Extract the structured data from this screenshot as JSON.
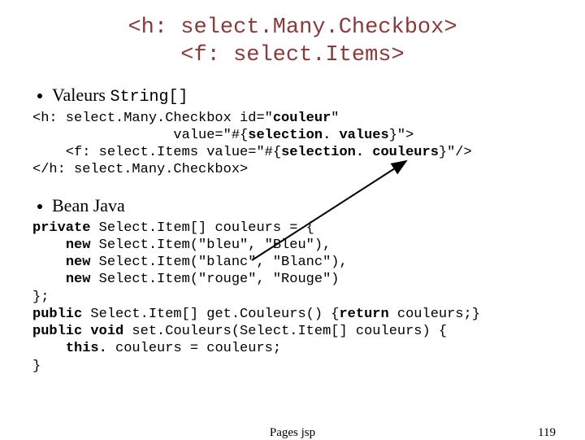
{
  "title_line1": "<h: select.Many.Checkbox>",
  "title_line2": "<f: select.Items>",
  "bullet1_text": "Valeurs ",
  "bullet1_code": "String[]",
  "code1_l1a": "<h: select.Many.Checkbox id=\"",
  "code1_l1b": "couleur",
  "code1_l1c": "\"",
  "code1_l2a": "                 value=\"#{",
  "code1_l2b": "selection. values",
  "code1_l2c": "}\">",
  "code1_l3a": "    <f: select.Items value=\"#{",
  "code1_l3b": "selection. couleurs",
  "code1_l3c": "}\"/>",
  "code1_l4": "</h: select.Many.Checkbox>",
  "bullet2_text": "Bean Java",
  "code2_l1a": "private",
  "code2_l1b": " Select.Item[] couleurs = {",
  "code2_l2a": "    ",
  "code2_l2b": "new",
  "code2_l2c": " Select.Item(\"bleu\", \"Bleu\"),",
  "code2_l3a": "    ",
  "code2_l3b": "new",
  "code2_l3c": " Select.Item(\"blanc\", \"Blanc\"),",
  "code2_l4a": "    ",
  "code2_l4b": "new",
  "code2_l4c": " Select.Item(\"rouge\", \"Rouge\")",
  "code2_l5": "};",
  "code2_l6a": "public",
  "code2_l6b": " Select.Item[] get.Couleurs() {",
  "code2_l6c": "return",
  "code2_l6d": " couleurs;}",
  "code2_l7a": "public",
  "code2_l7b": " ",
  "code2_l7c": "void",
  "code2_l7d": " set.Couleurs(Select.Item[] couleurs) {",
  "code2_l8a": "    ",
  "code2_l8b": "this.",
  "code2_l8c": " couleurs = couleurs;",
  "code2_l9": "}",
  "footer_center": "Pages jsp",
  "footer_page": "119"
}
